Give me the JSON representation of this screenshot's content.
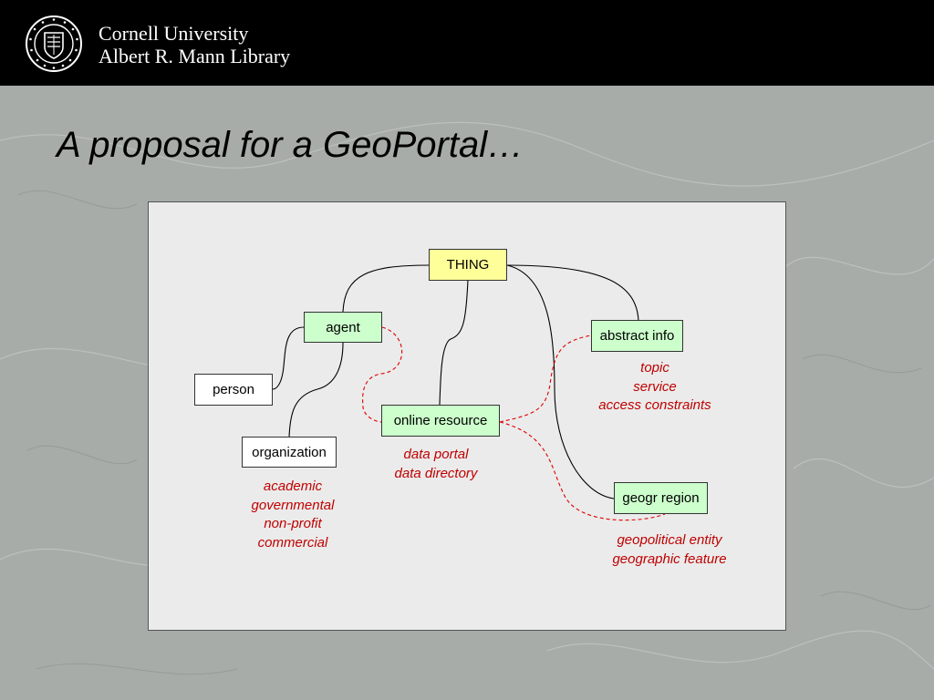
{
  "header": {
    "institution_line1": "Cornell University",
    "institution_line2": "Albert R. Mann Library",
    "seal_motto": "CORNELL UNIVERSITY FOUNDED A.D. 1865"
  },
  "slide": {
    "title": "A proposal for a GeoPortal…"
  },
  "diagram": {
    "nodes": {
      "thing": "THING",
      "agent": "agent",
      "person": "person",
      "organization": "organization",
      "online_resource": "online resource",
      "abstract_info": "abstract info",
      "geogr_region": "geogr region"
    },
    "annotations": {
      "organization_types": [
        "academic",
        "governmental",
        "non-profit",
        "commercial"
      ],
      "online_resource_types": [
        "data portal",
        "data directory"
      ],
      "abstract_info_types": [
        "topic",
        "service",
        "access constraints"
      ],
      "geogr_region_types": [
        "geopolitical entity",
        "geographic feature"
      ]
    },
    "colors": {
      "root_fill": "#ffff99",
      "class_fill": "#ccffcc",
      "leaf_fill": "#ffffff",
      "annotation_text": "#c00000",
      "relation_line": "#e00000"
    }
  }
}
